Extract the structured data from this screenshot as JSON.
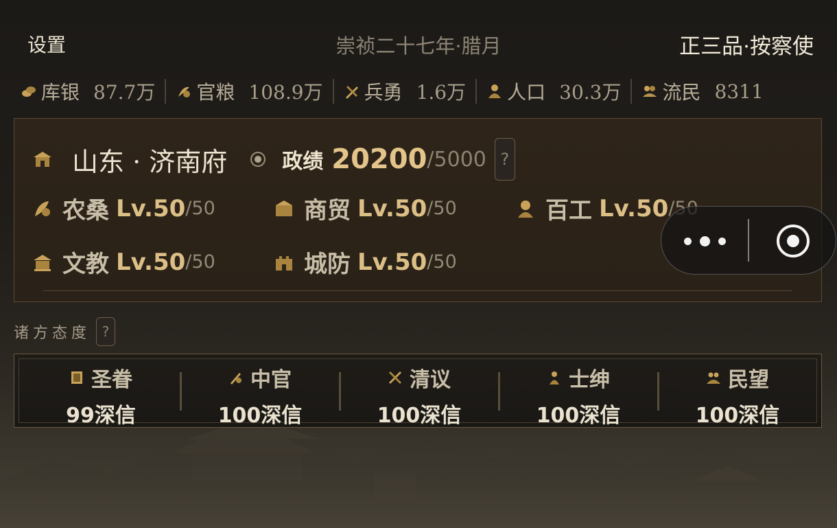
{
  "header": {
    "settings_label": "设置",
    "date": "崇祯二十七年·腊月",
    "rank": "正三品·按察使"
  },
  "resources": [
    {
      "icon": "silver-icon",
      "label": "库银",
      "value": "87.7万"
    },
    {
      "icon": "grain-icon",
      "label": "官粮",
      "value": "108.9万"
    },
    {
      "icon": "soldier-icon",
      "label": "兵勇",
      "value": "1.6万"
    },
    {
      "icon": "population-icon",
      "label": "人口",
      "value": "30.3万"
    },
    {
      "icon": "refugee-icon",
      "label": "流民",
      "value": "8311"
    }
  ],
  "region": {
    "icon": "city-gate-icon",
    "name": "山东 · 济南府",
    "merit_label": "政绩",
    "merit_value": "20200",
    "merit_max": "/5000",
    "help": "?",
    "skills": [
      {
        "icon": "farming-icon",
        "name": "农桑",
        "level": "Lv.50",
        "max": "/50"
      },
      {
        "icon": "trade-icon",
        "name": "商贸",
        "level": "Lv.50",
        "max": "/50"
      },
      {
        "icon": "craft-icon",
        "name": "百工",
        "level": "Lv.50",
        "max": "/50"
      },
      {
        "icon": "education-icon",
        "name": "文教",
        "level": "Lv.50",
        "max": "/50"
      },
      {
        "icon": "defense-icon",
        "name": "城防",
        "level": "Lv.50",
        "max": "/50"
      }
    ]
  },
  "attitudes": {
    "title": "诸方态度",
    "help": "?",
    "factions": [
      {
        "icon": "imperial-scroll-icon",
        "name": "圣眷",
        "value": "99深信"
      },
      {
        "icon": "eunuch-icon",
        "name": "中官",
        "value": "100深信"
      },
      {
        "icon": "scholar-icon",
        "name": "清议",
        "value": "100深信"
      },
      {
        "icon": "gentry-icon",
        "name": "士绅",
        "value": "100深信"
      },
      {
        "icon": "people-icon",
        "name": "民望",
        "value": "100深信"
      }
    ]
  },
  "colors": {
    "gold": "#dcbf86",
    "panel_bg": "#2c2218",
    "text_light": "#ece4d0"
  }
}
